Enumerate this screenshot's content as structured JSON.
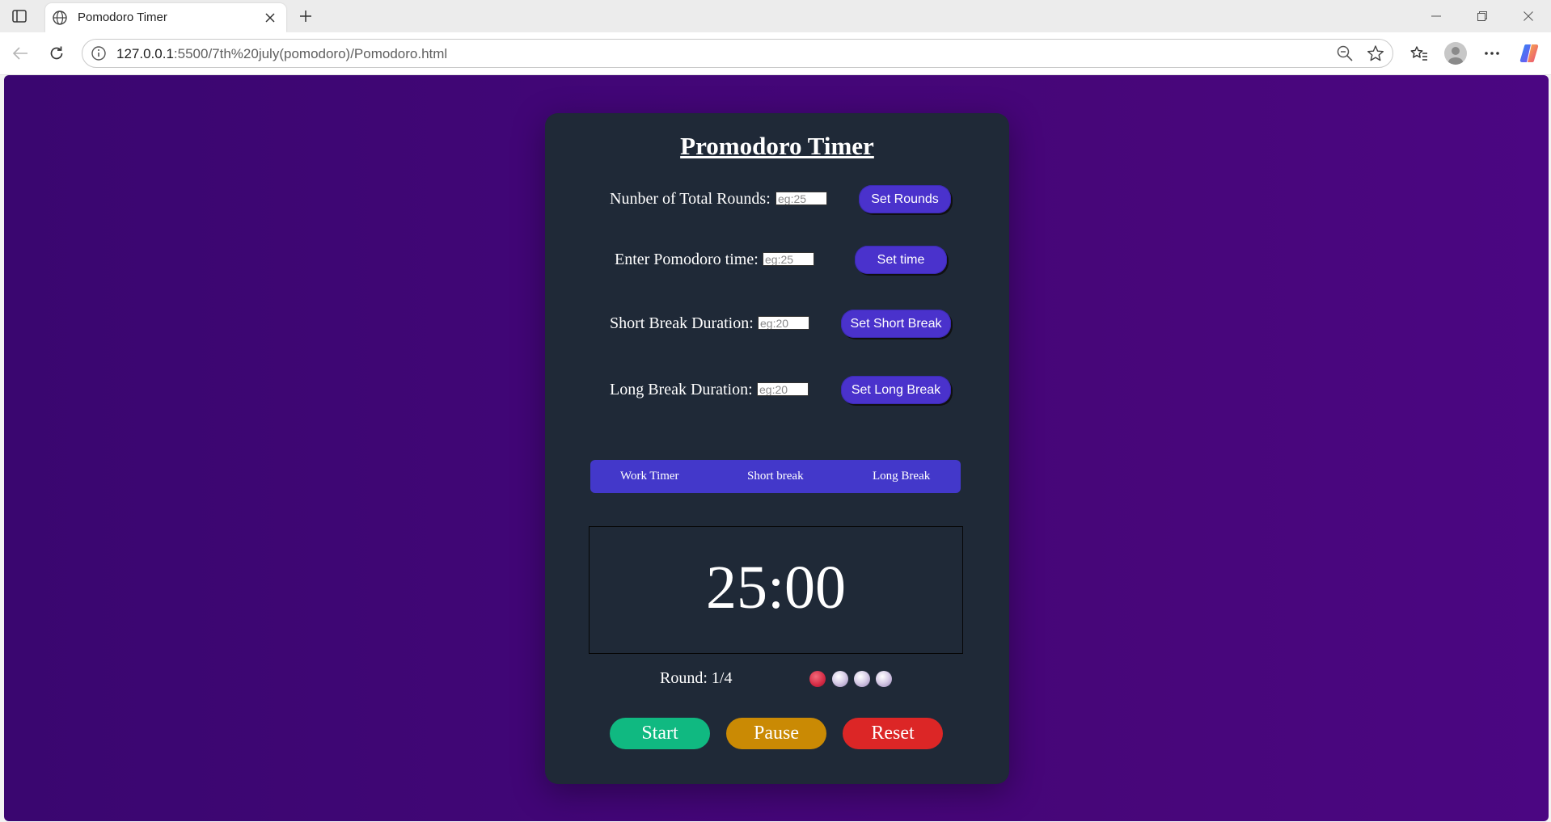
{
  "browser": {
    "tab_title": "Pomodoro Timer",
    "url_host": "127.0.0.1",
    "url_path": ":5500/7th%20july(pomodoro)/Pomodoro.html"
  },
  "app": {
    "title": "Promodoro Timer",
    "rounds": {
      "label": "Nunber of Total Rounds:",
      "placeholder": "eg:25",
      "button": "Set Rounds"
    },
    "pomodoro": {
      "label": "Enter Pomodoro time:",
      "placeholder": "eg:25",
      "button": "Set time"
    },
    "short_break": {
      "label": "Short Break Duration:",
      "placeholder": "eg:20",
      "button": "Set Short Break"
    },
    "long_break": {
      "label": "Long Break Duration:",
      "placeholder": "eg:20",
      "button": "Set Long Break"
    },
    "modes": [
      "Work Timer",
      "Short break",
      "Long Break"
    ],
    "timer": "25:00",
    "round_text": "Round: 1/4",
    "round_dots": [
      "active",
      "idle",
      "idle",
      "idle"
    ],
    "controls": {
      "start": "Start",
      "pause": "Pause",
      "reset": "Reset"
    }
  },
  "colors": {
    "background": "#420677",
    "card": "#1f2937",
    "accent": "#4338ca",
    "start": "#10b981",
    "pause": "#ca8a04",
    "reset": "#dc2626"
  }
}
